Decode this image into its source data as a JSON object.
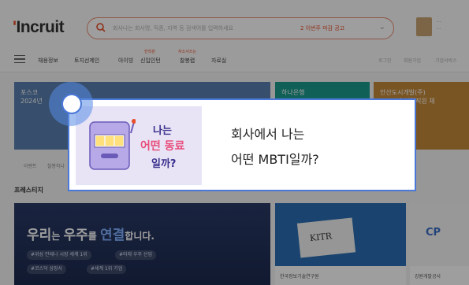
{
  "header": {
    "logo_prefix": "'",
    "logo_text": "Incruit",
    "search_placeholder": "회사나는 회사명, 직종, 지역 등 검색어를 입력하세요",
    "search_keyword": "2 이번주 마감 공고"
  },
  "nav": {
    "items": [
      "채용정보",
      "토지선제인",
      "아이빙",
      "신입인턴",
      "찰봉렵",
      "자료실"
    ],
    "badges": [
      "한직원",
      "자소서쓰는"
    ],
    "right": [
      "로그인",
      "회원가입",
      "기업서비스"
    ]
  },
  "banners": {
    "left_title": "포스코",
    "left_sub": "2024년",
    "mid_title": "하나은행",
    "right_title": "안산도시개발(주)",
    "right_sub": "2024년 신입직원 채"
  },
  "tabs": [
    "이벤트",
    "찰봉하나"
  ],
  "section_title": "프레스티지",
  "space_banner": {
    "title_a": "우리",
    "title_b": "는 ",
    "title_c": "우주",
    "title_d": "를 ",
    "title_e": "연결",
    "title_f": "합니다.",
    "chips": [
      "#위성 안테나 시장 세계 1위",
      "#미래 우주 산업",
      "#코스닥 상장사",
      "#세계 1위 기업"
    ]
  },
  "cards": [
    {
      "name": "KITR",
      "caption": "한국정보기술연구원"
    },
    {
      "name": "CP",
      "caption": "강원개발공사"
    }
  ],
  "modal": {
    "thumb_line1": "나는",
    "thumb_line2": "어떤 동료",
    "thumb_line3": "일까?",
    "question_line1": "회사에서 나는",
    "question_line2": "어떤 MBTI일까?"
  },
  "colors": {
    "accent": "#e94e2a",
    "highlight": "#4a78d8"
  }
}
